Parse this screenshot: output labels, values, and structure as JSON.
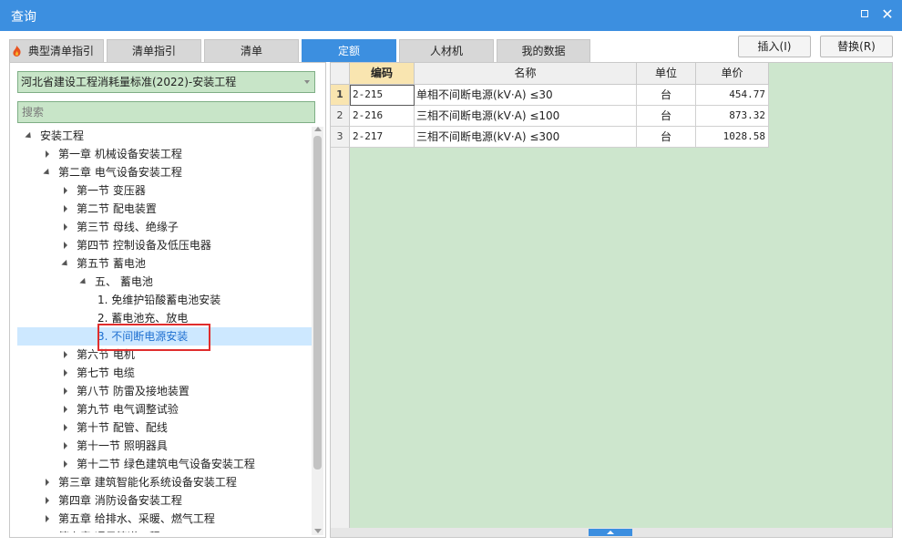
{
  "window": {
    "title": "查询"
  },
  "tabs": [
    {
      "label": "典型清单指引"
    },
    {
      "label": "清单指引"
    },
    {
      "label": "清单"
    },
    {
      "label": "定额"
    },
    {
      "label": "人材机"
    },
    {
      "label": "我的数据"
    }
  ],
  "actions": {
    "insert": "插入(I)",
    "replace": "替换(R)"
  },
  "library": {
    "selected": "河北省建设工程消耗量标准(2022)-安装工程"
  },
  "search": {
    "placeholder": "搜索"
  },
  "tree": [
    {
      "label": "安装工程",
      "level": 0,
      "state": "expanded"
    },
    {
      "label": "第一章 机械设备安装工程",
      "level": 1,
      "state": "collapsed"
    },
    {
      "label": "第二章 电气设备安装工程",
      "level": 1,
      "state": "expanded"
    },
    {
      "label": "第一节 变压器",
      "level": 2,
      "state": "collapsed"
    },
    {
      "label": "第二节 配电装置",
      "level": 2,
      "state": "collapsed"
    },
    {
      "label": "第三节 母线、绝缘子",
      "level": 2,
      "state": "collapsed"
    },
    {
      "label": "第四节 控制设备及低压电器",
      "level": 2,
      "state": "collapsed"
    },
    {
      "label": "第五节 蓄电池",
      "level": 2,
      "state": "expanded"
    },
    {
      "label": "五、 蓄电池",
      "level": 3,
      "state": "expanded"
    },
    {
      "label": "1. 免维护铅酸蓄电池安装",
      "level": 4,
      "state": "leaf"
    },
    {
      "label": "2. 蓄电池充、放电",
      "level": 4,
      "state": "leaf"
    },
    {
      "label": "3. 不间断电源安装",
      "level": 4,
      "state": "leaf",
      "selected": true
    },
    {
      "label": "第六节 电机",
      "level": 2,
      "state": "collapsed"
    },
    {
      "label": "第七节 电缆",
      "level": 2,
      "state": "collapsed"
    },
    {
      "label": "第八节 防雷及接地装置",
      "level": 2,
      "state": "collapsed"
    },
    {
      "label": "第九节 电气调整试验",
      "level": 2,
      "state": "collapsed"
    },
    {
      "label": "第十节 配管、配线",
      "level": 2,
      "state": "collapsed"
    },
    {
      "label": "第十一节 照明器具",
      "level": 2,
      "state": "collapsed"
    },
    {
      "label": "第十二节 绿色建筑电气设备安装工程",
      "level": 2,
      "state": "collapsed"
    },
    {
      "label": "第三章 建筑智能化系统设备安装工程",
      "level": 1,
      "state": "collapsed"
    },
    {
      "label": "第四章 消防设备安装工程",
      "level": 1,
      "state": "collapsed"
    },
    {
      "label": "第五章 给排水、采暖、燃气工程",
      "level": 1,
      "state": "collapsed"
    },
    {
      "label": "第六章 通风管道工程",
      "level": 1,
      "state": "collapsed"
    }
  ],
  "table": {
    "columns": [
      "编码",
      "名称",
      "单位",
      "单价"
    ],
    "rows": [
      {
        "num": "1",
        "code": "2-215",
        "name": "单相不间断电源(kV·A) ≤30",
        "unit": "台",
        "price": "454.77"
      },
      {
        "num": "2",
        "code": "2-216",
        "name": "三相不间断电源(kV·A) ≤100",
        "unit": "台",
        "price": "873.32"
      },
      {
        "num": "3",
        "code": "2-217",
        "name": "三相不间断电源(kV·A) ≤300",
        "unit": "台",
        "price": "1028.58"
      }
    ]
  },
  "colors": {
    "accent": "#3c8fe0",
    "pane_green": "#cde6cd",
    "highlight": "#e02d2d"
  }
}
